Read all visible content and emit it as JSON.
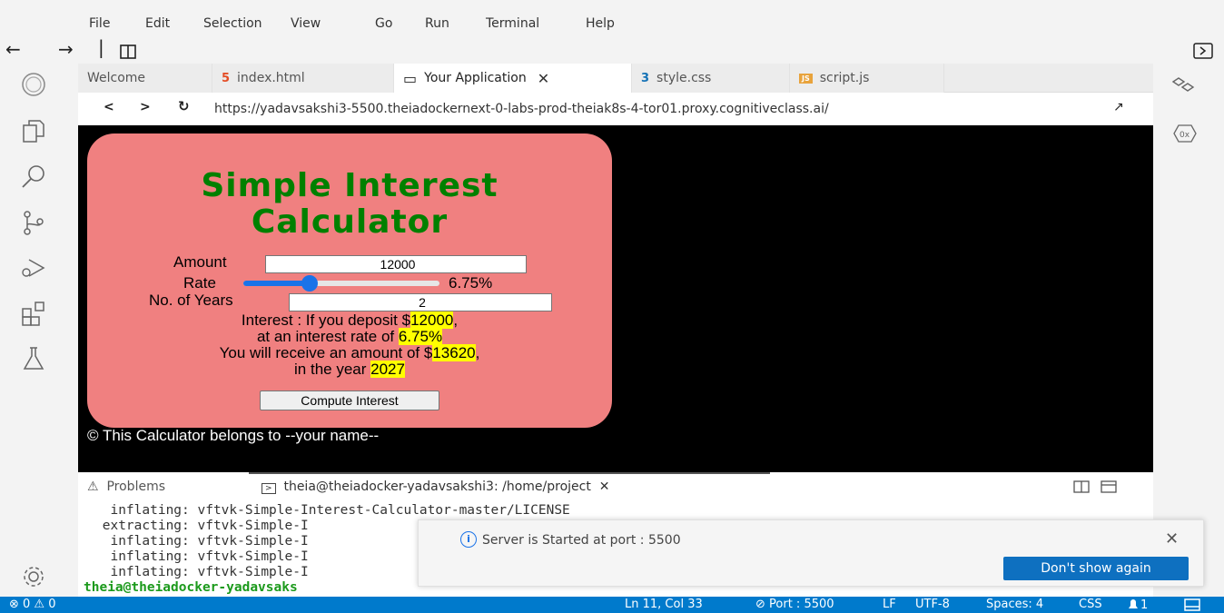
{
  "menu": [
    "File",
    "Edit",
    "Selection",
    "View",
    "Go",
    "Run",
    "Terminal",
    "Help"
  ],
  "nav": {
    "back": "←",
    "forward": "→",
    "sep": "|"
  },
  "tabs": [
    {
      "icon": "",
      "label": "Welcome"
    },
    {
      "icon": "5",
      "label": "index.html"
    },
    {
      "icon": "▭",
      "label": "Your Application",
      "close": "✕"
    },
    {
      "icon": "3",
      "label": "style.css"
    },
    {
      "icon": "JS",
      "label": "script.js"
    }
  ],
  "browser": {
    "back": "<",
    "forward": ">",
    "reload": "↻",
    "url": "https://yadavsakshi3-5500.theiadockernext-0-labs-prod-theiak8s-4-tor01.proxy.cognitiveclass.ai/",
    "external": "↗"
  },
  "app": {
    "title_line1": "Simple Interest",
    "title_line2": "Calculator",
    "amount_label": "Amount",
    "amount_value": "12000",
    "rate_label": "Rate",
    "rate_value": "6.75%",
    "rate_fraction": 0.34,
    "years_label": "No. of Years",
    "years_value": "2",
    "result_1a": "Interest : If you deposit $",
    "result_1b": "12000",
    "result_1c": ",",
    "result_2a": "at an interest rate of ",
    "result_2b": "6.75%",
    "result_3a": "You will receive an amount of $",
    "result_3b": "13620",
    "result_3c": ",",
    "result_4a": "in the year ",
    "result_4b": "2027",
    "compute_button": "Compute Interest",
    "footer": "© This Calculator belongs to --your name--"
  },
  "panel": {
    "problems_label": "Problems",
    "terminal_label": "theia@theiadocker-yadavsakshi3: /home/project",
    "terminal_close": "✕",
    "lines": [
      "  inflating: vftvk-Simple-Interest-Calculator-master/LICENSE",
      " extracting: vftvk-Simple-I",
      "  inflating: vftvk-Simple-I",
      "  inflating: vftvk-Simple-I",
      "  inflating: vftvk-Simple-I"
    ],
    "prompt": "theia@theiadocker-yadavsaks"
  },
  "notification": {
    "message": "Server is Started at port : 5500",
    "button": "Don't show again",
    "close": "✕",
    "info": "i"
  },
  "status": {
    "errors": "⊗ 0 ⚠ 0",
    "position": "Ln 11, Col 33",
    "port": "⊘ Port : 5500",
    "eol": "LF",
    "encoding": "UTF-8",
    "spaces": "Spaces: 4",
    "language": "CSS",
    "notifications": "1"
  },
  "colors": {
    "accent": "#007acc",
    "card": "#f08080",
    "title": "#008000",
    "highlight": "#ffff00"
  }
}
